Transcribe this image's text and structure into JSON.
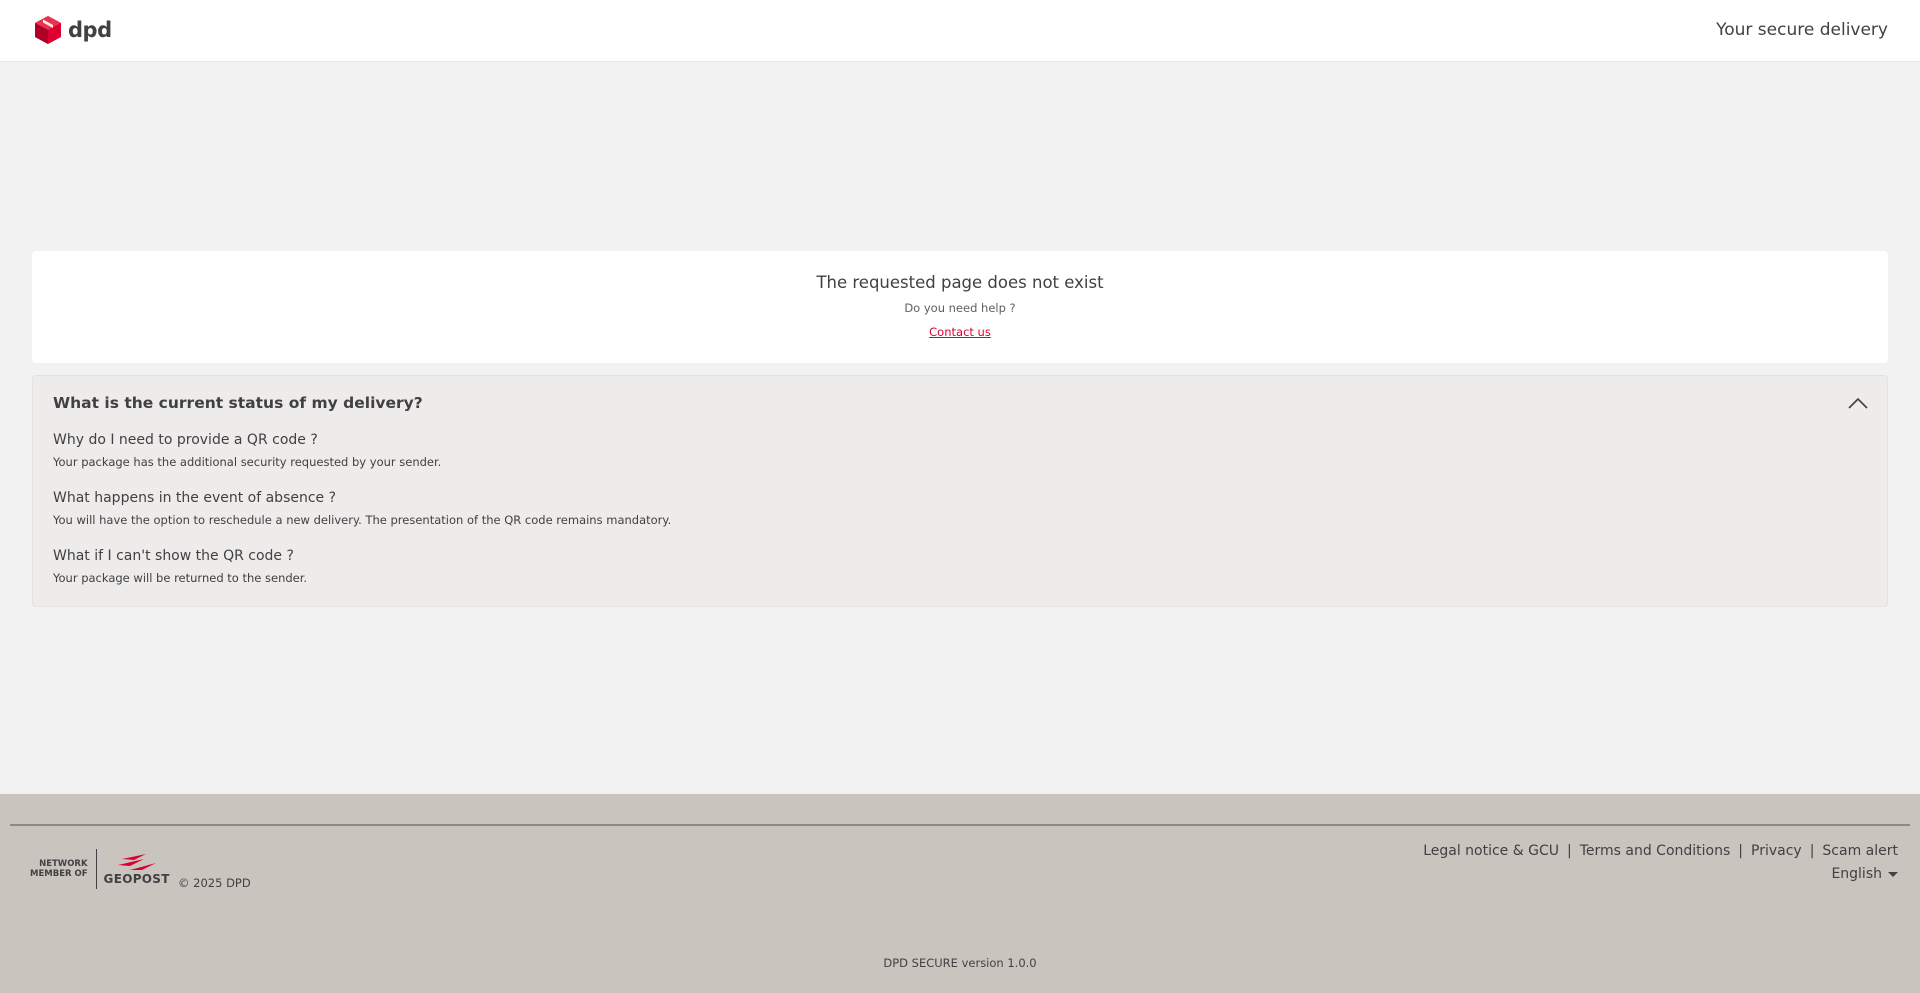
{
  "header": {
    "logo_text": "dpd",
    "title": "Your secure delivery"
  },
  "error": {
    "title": "The requested page does not exist",
    "help": "Do you need help ?",
    "contact_label": "Contact us"
  },
  "faq": {
    "title": "What is the current status of my delivery?",
    "expanded": true,
    "items": [
      {
        "question": "Why do I need to provide a QR code ?",
        "answer": "Your package has the additional security requested by your sender."
      },
      {
        "question": "What happens in the event of absence ?",
        "answer": "You will have the option to reschedule a new delivery. The presentation of the QR code remains mandatory."
      },
      {
        "question": "What if I can't show the QR code ?",
        "answer": "Your package will be returned to the sender."
      }
    ]
  },
  "footer": {
    "network_line1": "NETWORK",
    "network_line2": "MEMBER OF",
    "partner_name": "GEOPOST",
    "copyright": "© 2025 DPD",
    "links": [
      "Legal notice & GCU",
      "Terms and Conditions",
      "Privacy",
      "Scam alert"
    ],
    "language": "English",
    "version": "DPD SECURE version 1.0.0"
  },
  "colors": {
    "brand_red": "#dc0032",
    "text": "#414042",
    "footer_bg": "#cac4be"
  },
  "icons": {
    "logo": "dpd-cube-icon",
    "faq_toggle": "chevron-up-icon",
    "language": "caret-down-icon",
    "partner": "geopost-logo-icon"
  }
}
